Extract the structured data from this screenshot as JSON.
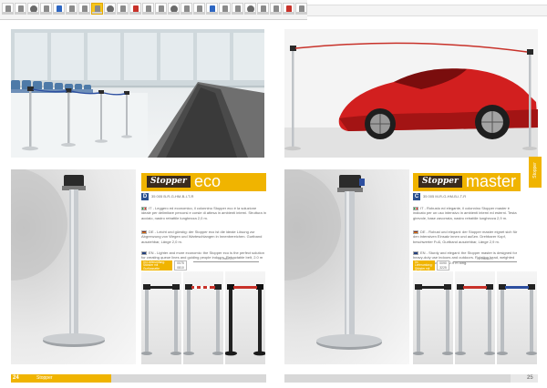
{
  "thumbnails": {
    "count": 24,
    "active_index": 7
  },
  "products": [
    {
      "logo": "Stopper",
      "name": "eco",
      "code_badge": "D",
      "code_text": "35 005 B-R-G-HM-B-I-T-R",
      "paragraphs": [
        "IT - Leggero ed economico, il colonnino Stopper eco è la soluzione ideale per delimitare percorsi e corsie di attesa in ambienti interni. Struttura in acciaio, nastro retrattile lunghezza 2,0 m.",
        "DE - Leicht und günstig: der Stopper eco ist die ideale Lösung zur Abgrenzung von Wegen und Warteschlangen in Innenbereichen. Gurtband ausziehbar, Länge 2,0 m.",
        "EN - Lighter and more economic: the Stopper eco is the perfect solution for creating queue lines and guiding people indoors. Retractable belt, 2.0 m long."
      ],
      "info_label": "Im Lieferumfang: Ständer mit Gurtkassette",
      "info_value": "0075 0810",
      "dim_label": "ca. 2900 mm"
    },
    {
      "logo": "Stopper",
      "name": "master",
      "code_badge": "C",
      "code_text": "35 005 M-R-G-HM-B-I-T-R",
      "paragraphs": [
        "IT - Robusto ed elegante, il colonnino Stopper master è indicato per un uso intensivo in ambienti interni ed esterni. Testa girevole, base zavorrata, nastro retrattile lunghezza 2,9 m.",
        "DE - Robust und elegant: der Stopper master eignet sich für den intensiven Einsatz innen und außen. Drehbarer Kopf, beschwerter Fuß, Gurtband ausziehbar, Länge 2,9 m.",
        "EN - Sturdy and elegant: the Stopper master is designed for heavy-duty use indoors and outdoors. Rotating head, weighted base, retractable belt, 2.9 m long."
      ],
      "info_label": "Im Lieferumfang: Ständer mit Gurtkassette",
      "info_value": "0090 3225",
      "dim_label": "ca. 2900 mm"
    }
  ],
  "side_tab": "Stopper",
  "footer": {
    "left_page": "24",
    "left_section": "Stopper",
    "right_page": "25"
  },
  "colors": {
    "accent": "#f0b400",
    "logo_bg": "#3a2b1e",
    "belt_blue": "#2d4fa0",
    "belt_black": "#222222",
    "belt_red": "#c8322a"
  }
}
